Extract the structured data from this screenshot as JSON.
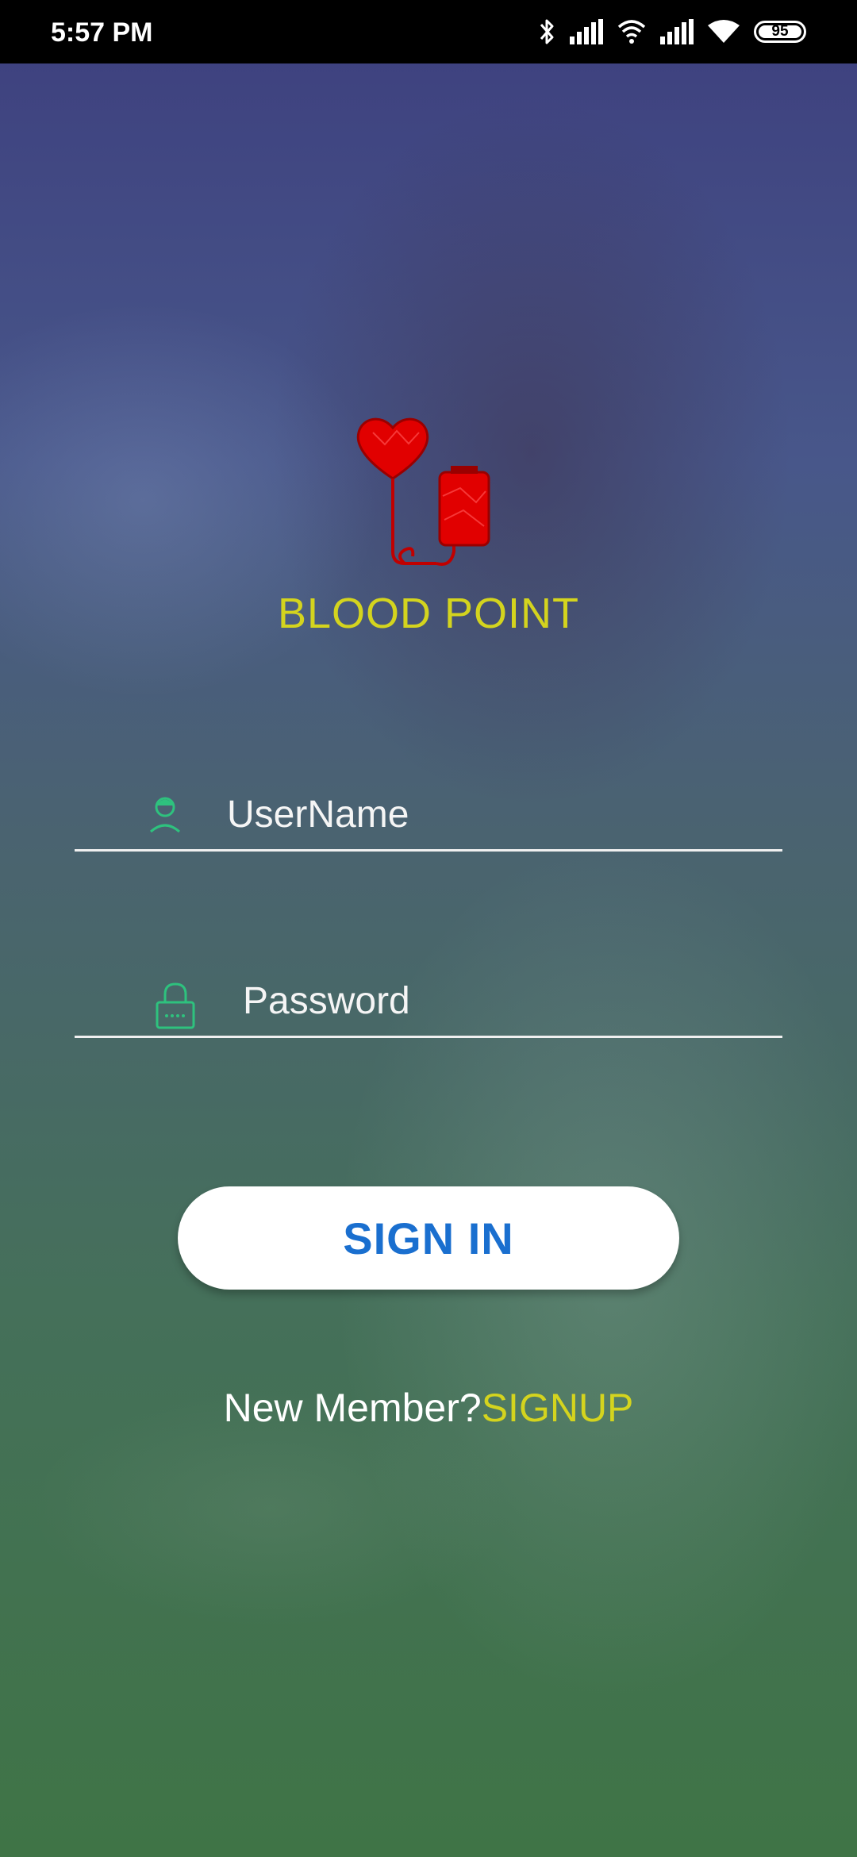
{
  "status_bar": {
    "time": "5:57 PM",
    "battery": "95",
    "icons": [
      "bluetooth-icon",
      "signal-icon",
      "wifi-calling-icon",
      "signal-icon",
      "wifi-icon",
      "battery-icon"
    ]
  },
  "app": {
    "title": "BLOOD POINT",
    "logo_icon": "heart-blood-bag-icon",
    "title_color": "#d4d41e"
  },
  "login": {
    "username_placeholder": "UserName",
    "username_value": "",
    "username_icon": "user-icon",
    "password_placeholder": "Password",
    "password_value": "",
    "password_icon": "lock-icon",
    "signin_label": "SIGN IN",
    "signin_color": "#1a6fcf"
  },
  "signup": {
    "prompt": "New Member?",
    "link": "SIGNUP"
  },
  "colors": {
    "accent_yellow": "#d4d41e",
    "icon_green": "#2ec27e",
    "heart_red": "#e10000"
  }
}
